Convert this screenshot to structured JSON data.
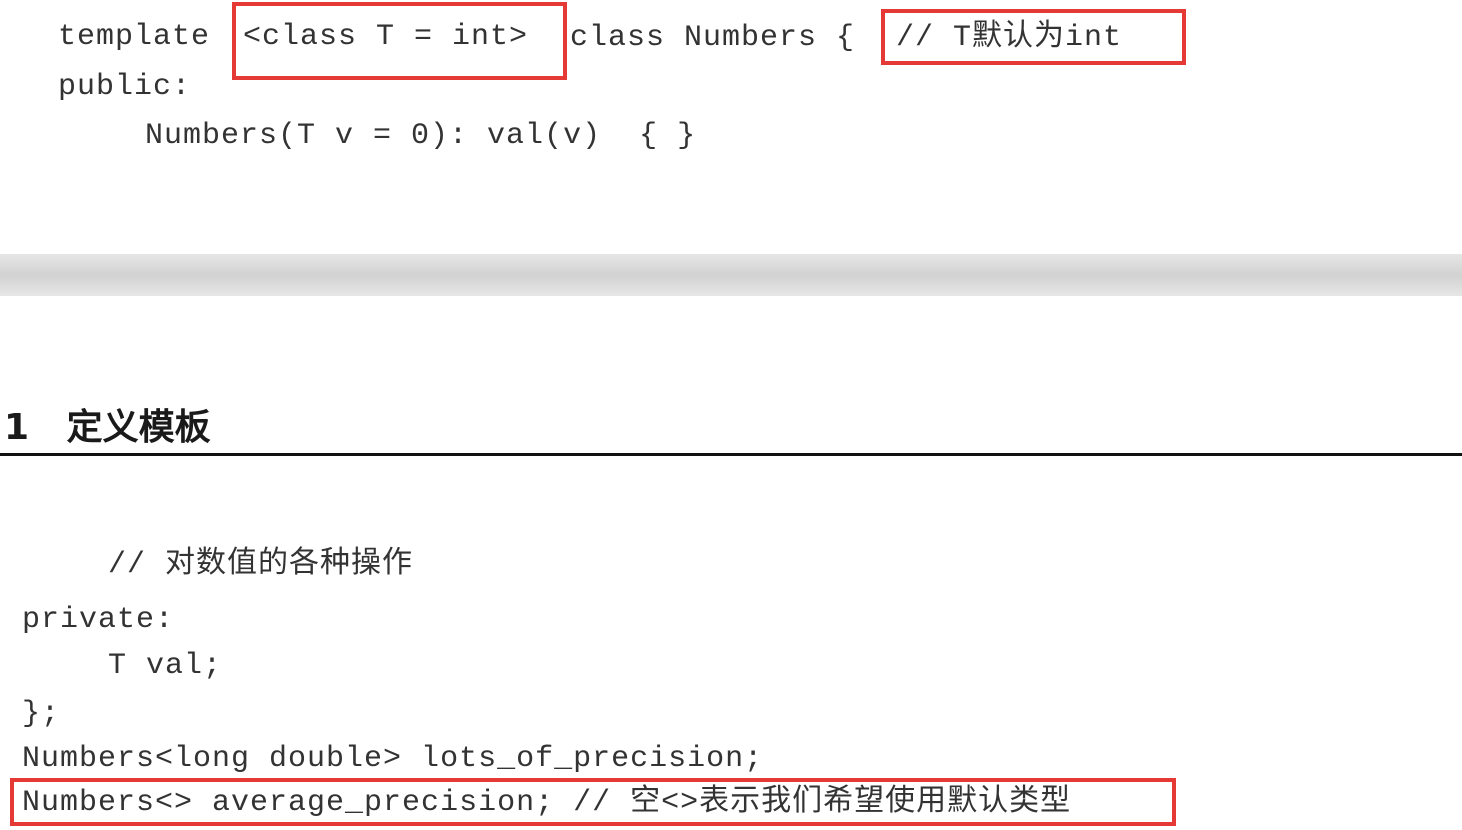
{
  "top_code": {
    "line1_keyword": "template",
    "line1_params": "<class T = int>",
    "line1_class": "class Numbers {",
    "line1_comment": "// T默认为int",
    "line2": "public:",
    "line3": "Numbers(T v = 0): val(v)  { }"
  },
  "section": {
    "number": "1",
    "title": "定义模板"
  },
  "bottom_code": {
    "comment": "// 对数值的各种操作",
    "private": "private:",
    "member": "T val;",
    "close": "};",
    "decl1": "Numbers<long double> lots_of_precision;",
    "decl2": "Numbers<> average_precision; // 空<>表示我们希望使用默认类型"
  },
  "colors": {
    "highlight": "#e53935"
  }
}
